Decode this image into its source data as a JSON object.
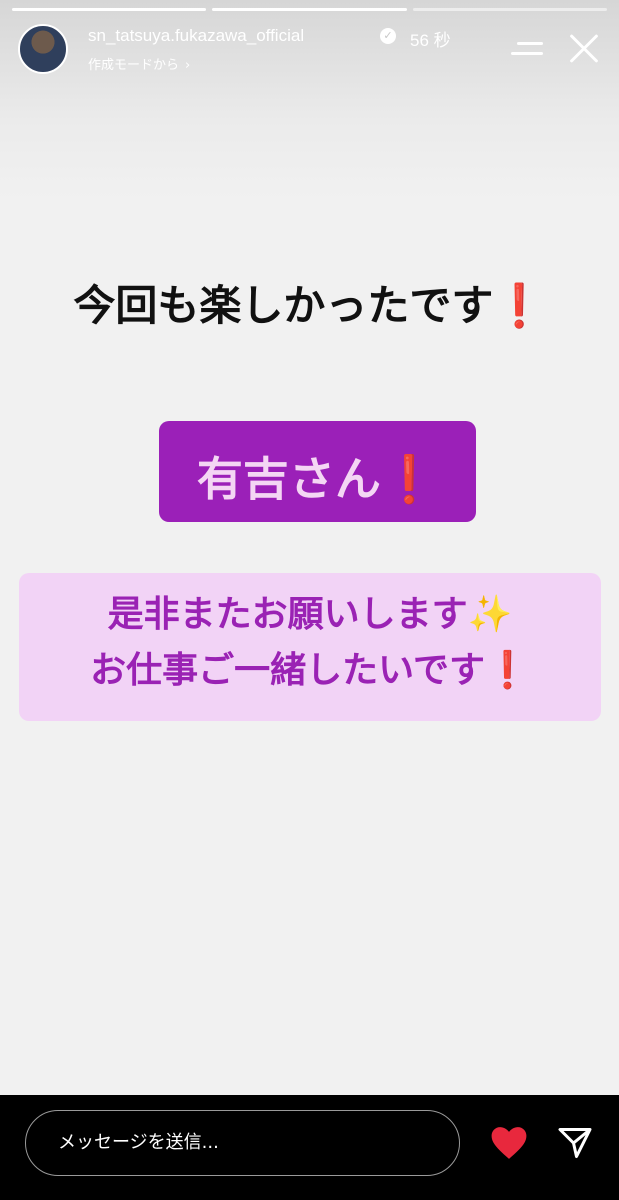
{
  "story": {
    "progress_segments": 3,
    "progress_active_index": 1,
    "username": "sn_tatsuya.fukazawa_official",
    "verified_icon": "verified-badge-icon",
    "time": "56 秒",
    "subtitle": "作成モードから",
    "subtitle_chevron": "›"
  },
  "content": {
    "line1": "今回も楽しかったです",
    "line2": "有吉さん",
    "line3a": "是非またお願いします",
    "line3b": "お仕事ご一緒したいです",
    "exclaim": "❗",
    "sparkle": "✨"
  },
  "colors": {
    "box2_bg": "#9b20b8",
    "box2_text": "#f4d6f4",
    "box3_bg": "#f2d3f6",
    "box3_text": "#9a22b4",
    "heart": "#e8283d"
  },
  "footer": {
    "message_placeholder": "メッセージを送信..."
  }
}
